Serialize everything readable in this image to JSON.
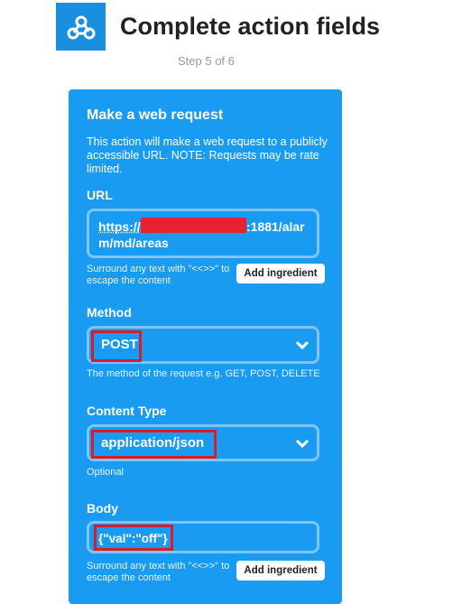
{
  "header": {
    "title": "Complete action fields",
    "step": "Step 5 of 6",
    "logo_icon": "webhook-icon"
  },
  "card": {
    "title": "Make a web request",
    "description": "This action will make a web request to a publicly accessible URL. NOTE: Requests may be rate limited.",
    "background_color": "#1a9bf2"
  },
  "url": {
    "label": "URL",
    "value_prefix": "https://",
    "value_suffix_line1": ":1881/alar",
    "value_line2": "m/md/areas",
    "hint": "Surround any text with \"<<>>\" to escape the content",
    "ingredient_button": "Add ingredient"
  },
  "method": {
    "label": "Method",
    "value": "POST",
    "hint": "The method of the request e.g. GET, POST, DELETE"
  },
  "content_type": {
    "label": "Content Type",
    "value": "application/json",
    "hint": "Optional"
  },
  "body": {
    "label": "Body",
    "value": "{\"val\":\"off\"}",
    "hint": "Surround any text with \"<<>>\" to escape the content",
    "ingredient_button": "Add ingredient"
  },
  "annotation_color": "#d91c2c"
}
